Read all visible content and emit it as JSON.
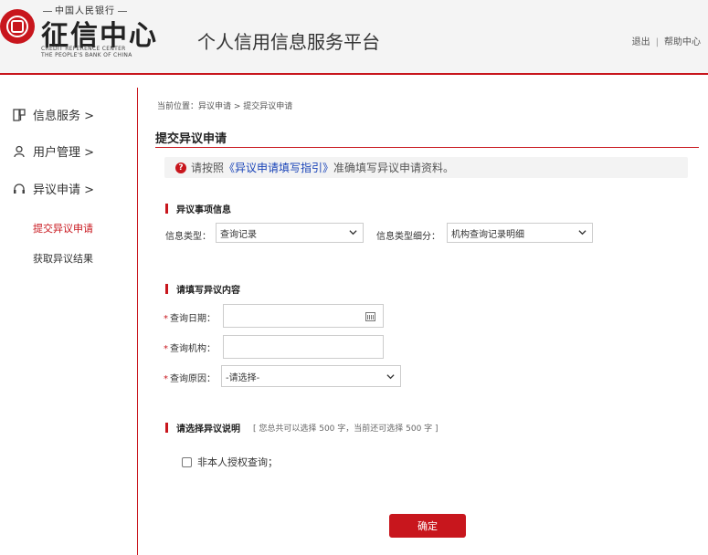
{
  "header": {
    "logo_bank": "中国人民银行",
    "logo_main": "征信中心",
    "logo_en_line1": "CREDIT REFERENCE CENTER",
    "logo_en_line2": "THE PEOPLE'S BANK OF CHINA",
    "platform_title": "个人信用信息服务平台",
    "link_logout": "退出",
    "link_separator": "|",
    "link_help": "帮助中心"
  },
  "sidebar": {
    "items": [
      {
        "label": "信息服务 >",
        "icon": "info-service-icon"
      },
      {
        "label": "用户管理 >",
        "icon": "user-icon"
      },
      {
        "label": "异议申请 >",
        "icon": "headset-icon"
      }
    ],
    "sub_items": [
      {
        "label": "提交异议申请",
        "active": true
      },
      {
        "label": "获取异议结果",
        "active": false
      }
    ]
  },
  "main": {
    "breadcrumb": "当前位置：异议申请 > 提交异议申请",
    "page_title": "提交异议申请",
    "notice": {
      "prefix": "请按照",
      "link": "《异议申请填写指引》",
      "suffix": "准确填写异议申请资料。"
    },
    "section1": {
      "title": "异议事项信息",
      "info_type_label": "信息类型：",
      "info_type_value": "查询记录",
      "info_subtype_label": "信息类型细分：",
      "info_subtype_value": "机构查询记录明细"
    },
    "section2": {
      "title": "请填写异议内容",
      "query_date_label": "查询日期：",
      "query_date_value": "",
      "query_org_label": "查询机构：",
      "query_org_value": "",
      "query_reason_label": "查询原因：",
      "query_reason_value": "-请选择-",
      "required_mark": "*"
    },
    "section3": {
      "title": "请选择异议说明",
      "hint": "[ 您总共可以选择 500 字，当前还可选择 500 字 ]",
      "checkbox_label": "非本人授权查询；",
      "checkbox_checked": false
    },
    "submit_label": "确定"
  },
  "colors": {
    "brand_red": "#c8161d",
    "link_blue": "#1a44b8"
  }
}
